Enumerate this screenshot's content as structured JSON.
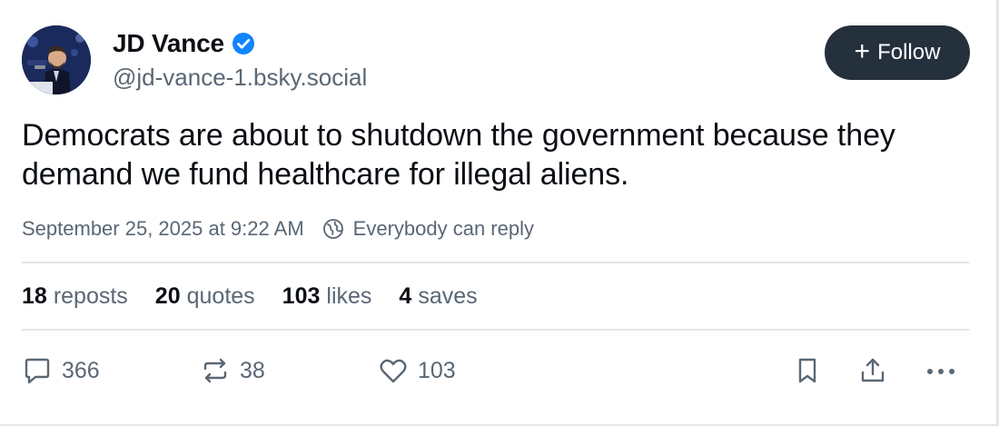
{
  "author": {
    "display_name": "JD Vance",
    "handle": "@jd-vance-1.bsky.social",
    "verified_icon": "verified-check-icon",
    "avatar": "avatar"
  },
  "follow_button": {
    "label": "Follow",
    "icon": "plus-icon",
    "plus_glyph": "+"
  },
  "post": {
    "text": "Democrats are about to shutdown the government because they demand we fund healthcare for illegal aliens.",
    "timestamp": "September 25, 2025 at 9:22 AM",
    "reply_setting": "Everybody can reply"
  },
  "stats": [
    {
      "count": "18",
      "label": "reposts"
    },
    {
      "count": "20",
      "label": "quotes"
    },
    {
      "count": "103",
      "label": "likes"
    },
    {
      "count": "4",
      "label": "saves"
    }
  ],
  "actions": {
    "reply_count": "366",
    "repost_count": "38",
    "like_count": "103"
  },
  "colors": {
    "accent": "#1185fe",
    "follow_bg": "#25303d",
    "secondary_text": "#5a6774",
    "divider": "#e3e6ea"
  }
}
